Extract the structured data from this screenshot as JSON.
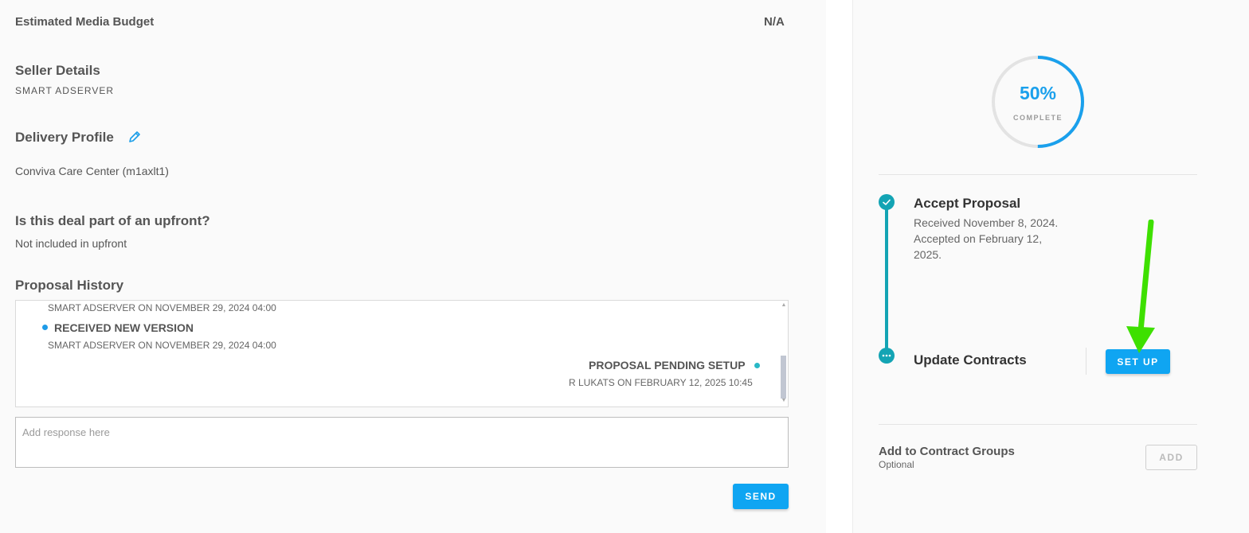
{
  "budget": {
    "label": "Estimated Media Budget",
    "value": "N/A"
  },
  "seller": {
    "label": "Seller Details",
    "value": "SMART ADSERVER"
  },
  "delivery": {
    "label": "Delivery Profile",
    "value": "Conviva Care Center (m1axlt1)",
    "edit_icon": "pencil-icon"
  },
  "upfront": {
    "label": "Is this deal part of an upfront?",
    "value": "Not included in upfront"
  },
  "history": {
    "label": "Proposal History",
    "entries": [
      {
        "meta": "SMART ADSERVER ON NOVEMBER 29, 2024 04:00"
      },
      {
        "title": "RECEIVED NEW VERSION",
        "meta": "SMART ADSERVER ON NOVEMBER 29, 2024 04:00",
        "dot_color": "#1e9be8"
      },
      {
        "title": "PROPOSAL PENDING SETUP",
        "meta": "R LUKATS ON FEBRUARY 12, 2025 10:45",
        "dot_color": "#29b8c6"
      }
    ]
  },
  "response": {
    "placeholder": "Add response here"
  },
  "send_label": "SEND",
  "progress": {
    "percent_text": "50%",
    "fraction": 0.5,
    "label": "COMPLETE",
    "color": "#1aa0ec",
    "track_color": "#e3e3e3"
  },
  "steps": [
    {
      "title": "Accept Proposal",
      "description": "Received November 8, 2024. Accepted on February 12, 2025.",
      "icon": "check-icon"
    },
    {
      "title": "Update Contracts",
      "button_label": "SET UP",
      "icon": "ellipsis-icon"
    }
  ],
  "contract_groups": {
    "label": "Add to Contract Groups",
    "sublabel": "Optional",
    "button_label": "ADD"
  },
  "colors": {
    "accent": "#0fa5f2",
    "step": "#13a4b4",
    "arrow": "#3ee000"
  }
}
